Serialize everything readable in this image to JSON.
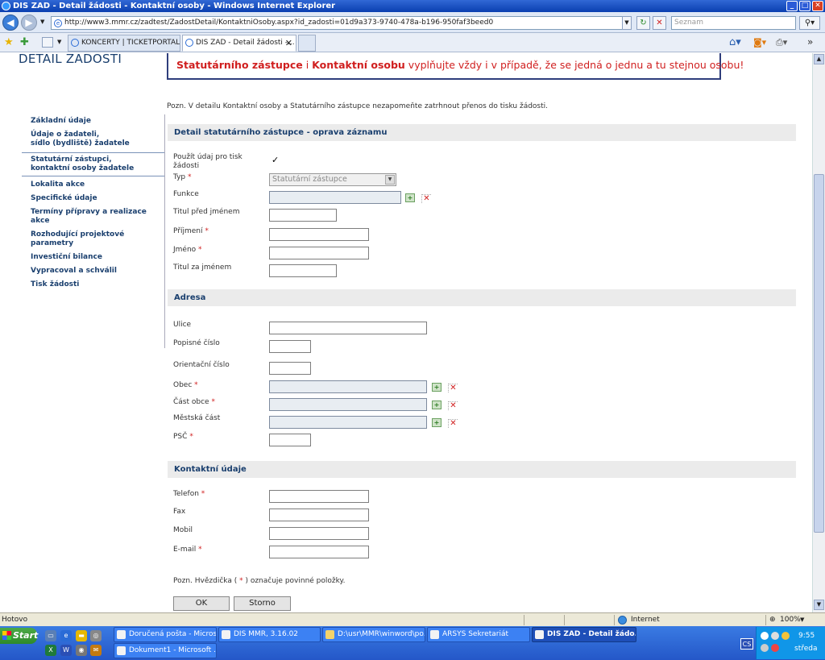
{
  "window": {
    "title": "DIS ZAD - Detail žádosti - Kontaktní osoby - Windows Internet Explorer"
  },
  "address": {
    "url": "http://www3.mmr.cz/zadtest/ZadostDetail/KontaktniOsoby.aspx?id_zadosti=01d9a373-9740-478a-b196-950faf3beed0",
    "search_placeholder": "Seznam"
  },
  "tabs": [
    {
      "label": "KONCERTY | TICKETPORTAL..."
    },
    {
      "label": "DIS ZAD - Detail žádosti -..."
    }
  ],
  "page": {
    "title": "DETAIL ŽÁDOSTI",
    "notice_part1": "Statutárního zástupce",
    "notice_part2": " i ",
    "notice_part3": "Kontaktní osobu",
    "notice_part4": " vyplňujte vždy i v případě, že se jedná o jednu a tu stejnou osobu!",
    "note_top": "Pozn. V detailu Kontaktní osoby a Statutárního zástupce nezapomeňte zatrhnout přenos do tisku žádosti.",
    "note_bottom_1": "Pozn. Hvězdička ( ",
    "note_bottom_star": "*",
    "note_bottom_2": " ) označuje povinné položky.",
    "required_mark": "*"
  },
  "sidebar": {
    "items": [
      {
        "label": "Základní údaje"
      },
      {
        "label1": "Údaje o žadateli,",
        "label2": "sídlo (bydliště) žadatele"
      },
      {
        "label1": "Statutární zástupci,",
        "label2": "kontaktní osoby žadatele"
      },
      {
        "label": "Lokalita akce"
      },
      {
        "label": "Specifické údaje"
      },
      {
        "label": "Termíny přípravy a realizace akce"
      },
      {
        "label": "Rozhodující projektové parametry"
      },
      {
        "label": "Investiční bilance"
      },
      {
        "label": "Vypracoval a schválil"
      },
      {
        "label": "Tisk žádosti"
      }
    ]
  },
  "sections": {
    "detail": "Detail statutárního zástupce - oprava záznamu",
    "adresa": "Adresa",
    "kontakt": "Kontaktní údaje"
  },
  "fields": {
    "pouzit1": "Použít údaj pro tisk",
    "pouzit2": "žádosti",
    "typ": "Typ",
    "typ_value": "Statutární zástupce",
    "funkce": "Funkce",
    "titul_pred": "Titul před jménem",
    "prijmeni": "Příjmení",
    "jmeno": "Jméno",
    "titul_za": "Titul za jménem",
    "ulice": "Ulice",
    "popisne": "Popisné číslo",
    "orientacni": "Orientační číslo",
    "obec": "Obec",
    "cast_obce": "Část obce",
    "mestska_cast": "Městská část",
    "psc": "PSČ",
    "telefon": "Telefon",
    "fax": "Fax",
    "mobil": "Mobil",
    "email": "E-mail"
  },
  "buttons": {
    "ok": "OK",
    "storno": "Storno"
  },
  "statusbar": {
    "status": "Hotovo",
    "zone": "Internet",
    "zoom": "100%"
  },
  "taskbar": {
    "start": "Start",
    "tasks": [
      {
        "label": "Doručená pošta - Micros..."
      },
      {
        "label": "DIS MMR, 3.16.02"
      },
      {
        "label": "D:\\usr\\MMR\\winword\\po..."
      },
      {
        "label": "ARSYS Sekretariát"
      },
      {
        "label": "DIS ZAD - Detail žádo..."
      },
      {
        "label": "Dokument1 - Microsoft ..."
      }
    ],
    "lang": "CS",
    "time": "9:55",
    "day": "středa"
  }
}
